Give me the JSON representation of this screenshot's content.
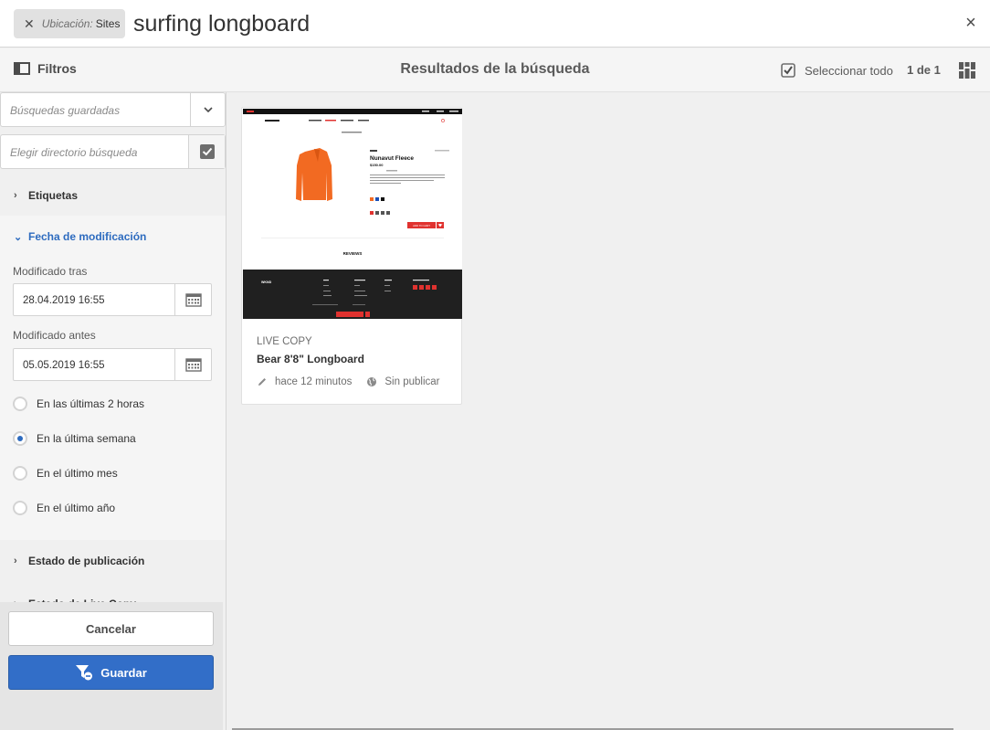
{
  "search": {
    "location_label": "Ubicación:",
    "location_value": "Sites",
    "query": "surfing longboard"
  },
  "header": {
    "filters_label": "Filtros",
    "title": "Resultados de la búsqueda",
    "select_all_label": "Seleccionar todo",
    "pager": "1 de 1"
  },
  "filters": {
    "saved_searches_placeholder": "Búsquedas guardadas",
    "directory_placeholder": "Elegir directorio búsqueda",
    "tags_label": "Etiquetas",
    "modified_date_label": "Fecha de modificación",
    "modified_after_label": "Modificado tras",
    "modified_after_value": "28.04.2019 16:55",
    "modified_before_label": "Modificado antes",
    "modified_before_value": "05.05.2019 16:55",
    "radios": [
      {
        "label": "En las últimas 2 horas",
        "checked": false
      },
      {
        "label": "En la última semana",
        "checked": true
      },
      {
        "label": "En el último mes",
        "checked": false
      },
      {
        "label": "En el último año",
        "checked": false
      }
    ],
    "publication_status_label": "Estado de publicación",
    "next_section_partial": "Estado de Live Copy"
  },
  "actions": {
    "cancel_label": "Cancelar",
    "save_label": "Guardar"
  },
  "result": {
    "type": "LIVE COPY",
    "title": "Bear 8'8\" Longboard",
    "modified": "hace 12 minutos",
    "status": "Sin publicar",
    "thumbnail": {
      "brand": "WKND",
      "product_name": "Nunavut Fleece",
      "price": "$150.00",
      "cta": "ADD TO CART",
      "section": "REVIEWS"
    }
  },
  "colors": {
    "accent": "#326ec8",
    "link": "#2d6bbf",
    "thumb_red": "#e0322f",
    "jacket": "#f26a22",
    "footer_dark": "#202020"
  }
}
